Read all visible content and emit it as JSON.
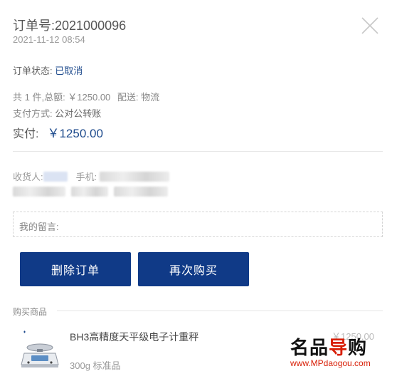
{
  "order": {
    "number_label": "订单号:",
    "number": "2021000096",
    "time": "2021-11-12 08:54",
    "status_label": "订单状态:",
    "status_value": "已取消",
    "count_text": "共 1 件,总额: ￥1250.00",
    "delivery_text": "配送: 物流",
    "pay_method_label": "支付方式:",
    "pay_method_value": "公对公转账",
    "actual_label": "实付:",
    "actual_amount": "￥1250.00"
  },
  "receiver": {
    "name_label": "收货人:",
    "phone_label": "手机:"
  },
  "message": {
    "label": "我的留言:"
  },
  "actions": {
    "delete_label": "删除订单",
    "rebuy_label": "再次购买"
  },
  "goods": {
    "heading": "购买商品",
    "items": [
      {
        "name": "BH3高精度天平级电子计重秤",
        "spec": "300g 标准品",
        "price": "￥1250.00"
      }
    ]
  },
  "watermark": {
    "brand_black_1": "名品",
    "brand_red": "导",
    "brand_black_2": "购",
    "url": "www.MPdaogou.com"
  },
  "colors": {
    "accent": "#103a87",
    "status": "#1d4a8c",
    "watermark_red": "#d81e06"
  },
  "icons": {
    "close": "close-icon",
    "product": "scale-product-image"
  }
}
